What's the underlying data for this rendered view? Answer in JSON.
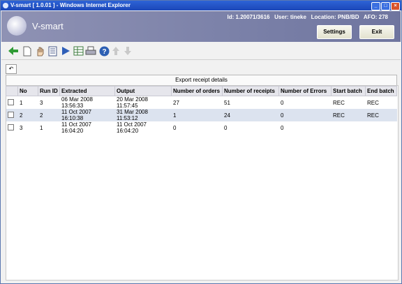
{
  "window": {
    "title": "V-smart [ 1.0.01 ] - Windows Internet Explorer"
  },
  "header": {
    "logo_text": "V-smart",
    "id_label": "Id: 1.20071/3616",
    "user_label": "User: tineke",
    "location_label": "Location: PNB/BD",
    "afo_label": "AFO: 278",
    "settings_label": "Settings",
    "exit_label": "Exit"
  },
  "toolbar": {
    "icons": [
      "back-arrow-icon",
      "new-document-icon",
      "hand-select-icon",
      "details-list-icon",
      "play-run-icon",
      "table-output-icon",
      "print-icon",
      "help-icon",
      "move-up-icon",
      "move-down-icon"
    ]
  },
  "section_title": "Export receipt details",
  "table": {
    "columns": [
      "No",
      "Run ID",
      "Extracted",
      "Output",
      "Number of orders",
      "Number of receipts",
      "Number of Errors",
      "Start batch",
      "End batch"
    ],
    "rows": [
      [
        "1",
        "3",
        "06 Mar 2008 13:56:33",
        "20 Mar 2008 11:57:45",
        "27",
        "51",
        "0",
        "REC",
        "REC"
      ],
      [
        "2",
        "2",
        "11 Oct 2007 16:10:38",
        "31 Mar 2008 11:53:12",
        "1",
        "24",
        "0",
        "REC",
        "REC"
      ],
      [
        "3",
        "1",
        "11 Oct 2007 16:04:20",
        "11 Oct 2007 16:04:20",
        "0",
        "0",
        "0",
        "",
        ""
      ]
    ]
  },
  "colors": {
    "banner": "#7c82a9",
    "titlebar": "#1c47b8",
    "selected_row": "#dce3ef"
  }
}
